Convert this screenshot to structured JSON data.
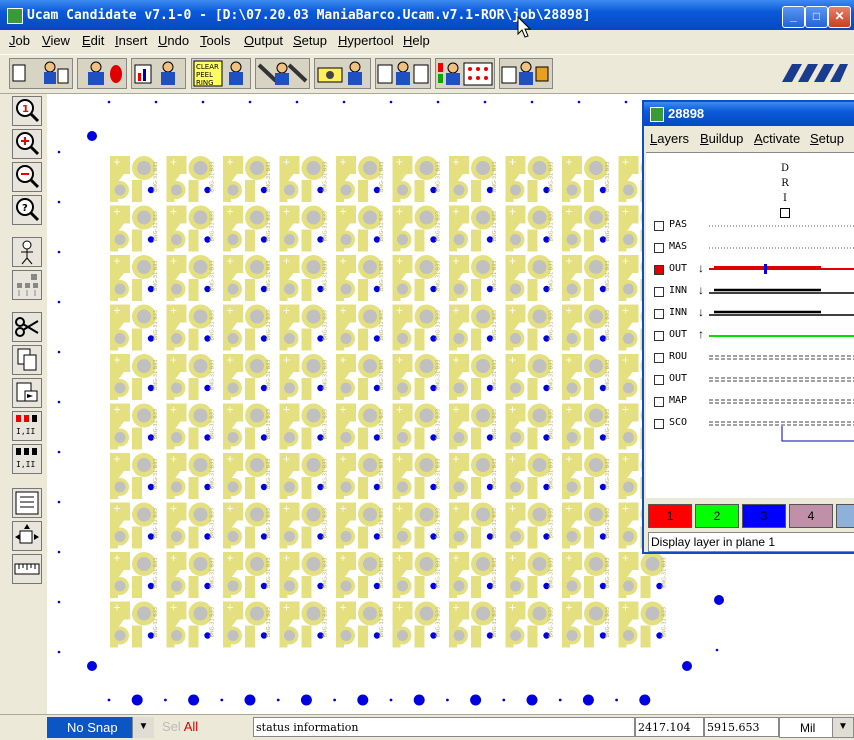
{
  "window": {
    "title": "Ucam Candidate v7.1-0 - [D:\\07.20.03 ManiaBarco.Ucam.v7.1-ROR\\job\\28898]",
    "controls": [
      "_",
      "□",
      "✕"
    ]
  },
  "menu": {
    "items": [
      {
        "label": "Job",
        "accel": "J"
      },
      {
        "label": "View",
        "accel": "V"
      },
      {
        "label": "Edit",
        "accel": "E"
      },
      {
        "label": "Insert",
        "accel": "I"
      },
      {
        "label": "Undo",
        "accel": "U"
      },
      {
        "label": "Tools",
        "accel": "T"
      },
      {
        "label": "Output",
        "accel": "O"
      },
      {
        "label": "Setup",
        "accel": "S"
      },
      {
        "label": "Hypertool",
        "accel": "H"
      },
      {
        "label": "Help",
        "accel": "H"
      }
    ]
  },
  "toolbar": {
    "tools": [
      "job-tool",
      "person-tool",
      "chart-tool",
      "grid-tool",
      "clear-peel-tool",
      "wrench-tool",
      "camera-tool",
      "frames-tool",
      "components-tool",
      "export-tool"
    ],
    "clear_label": [
      "CLEAR",
      "PEEL",
      "RING"
    ]
  },
  "left_tools": [
    "zoom-1-icon",
    "zoom-in-icon",
    "zoom-out-icon",
    "zoom-query-icon",
    "person-icon",
    "tree-icon",
    "scissors-icon",
    "copy-icon",
    "paste-icon",
    "matrix-icon",
    "matrix-icon",
    "list-icon",
    "transform-icon",
    "ruler-icon"
  ],
  "status": {
    "snap": "No Snap",
    "sel_prefix": "Sel",
    "sel_value": "All",
    "info": "status information",
    "x": "2417.104",
    "y": "5915.653",
    "unit": "Mil"
  },
  "layers_window": {
    "title": "28898",
    "menu": [
      {
        "label": "Layers",
        "accel": "L"
      },
      {
        "label": "Buildup",
        "accel": "B"
      },
      {
        "label": "Activate",
        "accel": "A"
      },
      {
        "label": "Setup",
        "accel": "S"
      }
    ],
    "dri": [
      "D",
      "R",
      "I"
    ],
    "layers": [
      {
        "name": "PAS",
        "style": "dotted",
        "checked": false,
        "arrow": ""
      },
      {
        "name": "MAS",
        "style": "dotted",
        "checked": false,
        "arrow": ""
      },
      {
        "name": "OUT",
        "style": "red",
        "checked": true,
        "arrow": "↓"
      },
      {
        "name": "INN",
        "style": "black",
        "checked": false,
        "arrow": "↓"
      },
      {
        "name": "INN",
        "style": "black",
        "checked": false,
        "arrow": "↓"
      },
      {
        "name": "OUT",
        "style": "green",
        "checked": false,
        "arrow": "↑"
      },
      {
        "name": "ROU",
        "style": "dashed",
        "checked": false,
        "arrow": ""
      },
      {
        "name": "OUT",
        "style": "dashed",
        "checked": false,
        "arrow": ""
      },
      {
        "name": "MAP",
        "style": "dashed",
        "checked": false,
        "arrow": ""
      },
      {
        "name": "SCO",
        "style": "dashed",
        "checked": false,
        "arrow": ""
      }
    ],
    "palette": [
      {
        "label": "1",
        "color": "#ff0000"
      },
      {
        "label": "2",
        "color": "#00ff00"
      },
      {
        "label": "3",
        "color": "#0000ff"
      },
      {
        "label": "4",
        "color": "#c090a8"
      },
      {
        "label": "",
        "color": "#8fb0d8"
      }
    ],
    "status": "Display layer in plane 1"
  },
  "pcb": {
    "board_color": "#ffffff",
    "copper_color": "#e4e080",
    "pad_color": "#c0c0c0",
    "via_color": "#0000e0",
    "columns": 10,
    "rows": 10,
    "board_text": "BNG-31 B33"
  }
}
